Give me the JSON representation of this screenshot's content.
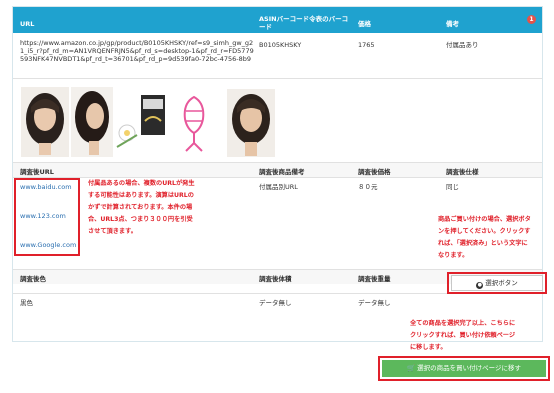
{
  "header": {
    "col_url": "URL",
    "col_barcode": "ASINバーコード令表のバーコード",
    "col_price": "価格",
    "col_note": "備考",
    "badge": "1"
  },
  "row": {
    "url": "https://www.amazon.co.jp/gp/product/B0105KHSKY/ref=s9_simh_gw_g21_i5_r?pf_rd_m=AN1VRQENFRJN5&pf_rd_s=desktop-1&pf_rd_r=FD5779593NFK47NVBDT1&pf_rd_t=36701&pf_rd_p=9d539fa0-72bc-4756-8b9",
    "asin": "B0105KHSKY",
    "price": "1765",
    "note": "付属品あり"
  },
  "investigation": {
    "hdr_url": "調査後URL",
    "hdr_note": "調査後商品備考",
    "hdr_price": "調査後価格",
    "hdr_spec": "調査後仕様",
    "links": [
      "www.baidu.com",
      "www.123.com",
      "www.Google.com"
    ],
    "note_value": "付属品別URL",
    "price_value": "８０元",
    "spec_value": "同じ",
    "hdr_color": "調査後色",
    "hdr_weight": "調査後体積",
    "hdr_heavy": "調査後重量",
    "color_value": "黒色",
    "weight_value": "データ無し",
    "heavy_value": "データ無し"
  },
  "annotations": {
    "left": [
      "付属品あるの場合、複数のURLが発生",
      "する可能性はあります。演算はURLの",
      "かずで計算されております。本件の場",
      "合、URL3点、つまり３００円を引受",
      "させて頂きます。"
    ],
    "right": [
      "商品ご買い付けの場合、選択ボタ",
      "ンを押してください。クリックす",
      "れば、「選択済み」という文字に",
      "なります。"
    ],
    "bottom": [
      "全ての商品を選択完了以上、こちらに",
      "クリックすれば、買い付け依頼ページ",
      "に移します。"
    ]
  },
  "buttons": {
    "select": "選択ボタン",
    "go": "選択の商品を買い付けページに移す"
  },
  "colors": {
    "header_bg": "#1fa2cf",
    "annotation_red": "#e0202a",
    "go_button": "#5cb85c",
    "link": "#2a6fb0"
  }
}
